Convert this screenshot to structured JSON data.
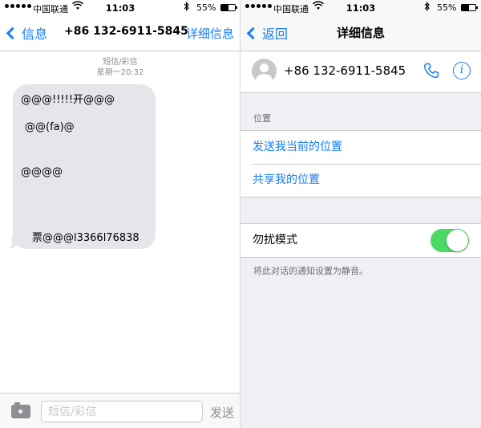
{
  "status_bar": {
    "carrier": "中国联通",
    "time": "11:03",
    "battery_percent": "55%",
    "battery_level": 0.55
  },
  "conversation": {
    "nav": {
      "back_label": "信息",
      "title": "+86 132-6911-5845",
      "details_label": "详细信息"
    },
    "message_type": "短信/彩信",
    "timestamp": "星期一20:32",
    "message_lines": [
      "@@@!!!!!开@@@",
      "@@(fa)@",
      "@@@@",
      "票@@@l3366l76838"
    ],
    "input": {
      "placeholder": "短信/彩信",
      "value": "",
      "send_label": "发送"
    }
  },
  "details": {
    "nav": {
      "back_label": "返回",
      "title": "详细信息"
    },
    "contact_number": "+86 132-6911-5845",
    "location_header": "位置",
    "send_location": "发送我当前的位置",
    "share_location": "共享我的位置",
    "do_not_disturb": {
      "label": "勿扰模式",
      "enabled": true
    },
    "dnd_note": "将此对话的通知设置为静音。"
  },
  "colors": {
    "accent": "#157efb",
    "toggle_on": "#4cd964",
    "bubble": "#e5e5ea"
  },
  "icons": [
    "wifi-icon",
    "bluetooth-icon",
    "battery-icon",
    "chevron-left-icon",
    "camera-icon",
    "avatar",
    "phone-icon",
    "info-icon"
  ]
}
